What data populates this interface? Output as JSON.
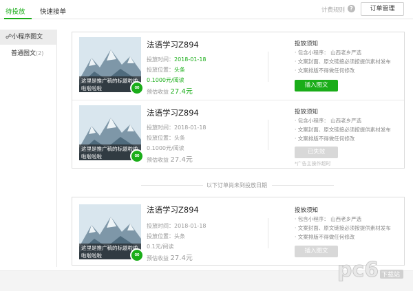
{
  "header": {
    "tabs": [
      {
        "label": "待投放"
      },
      {
        "label": "快速接单"
      }
    ],
    "billing_rules": "计费规则",
    "help_icon": "?",
    "order_manage": "订单管理"
  },
  "sidebar": {
    "items": [
      {
        "label": "小程序图文",
        "count": ""
      },
      {
        "label": "普通图文",
        "count": "(2)"
      }
    ]
  },
  "cards": [
    {
      "caption": "这里是推广稿的标题啦啦啦啦啦啦",
      "title": "法语学习Z894",
      "time_label": "投放时间：",
      "time": "2018-01-18",
      "position_label": "投放位置：",
      "position": "头条",
      "price": "0.1000元/阅读",
      "earn_label": "预估收益",
      "earn": "27.4元",
      "notice_title": "投放须知",
      "notices": [
        "· 包含小程序：  山西老乡严选",
        "· 文案封面、原文链接必须按提供素材发布",
        "· 文案排版不得做任何修改"
      ],
      "button": "插入图文",
      "button_state": "active",
      "note": ""
    },
    {
      "caption": "这里是推广稿的标题啦啦啦啦啦啦",
      "title": "法语学习Z894",
      "time_label": "投放时间：",
      "time": "2018-01-18",
      "position_label": "投放位置：",
      "position": "头条",
      "price": "0.1000元/阅读",
      "earn_label": "预估收益",
      "earn": "27.4元",
      "notice_title": "投放须知",
      "notices": [
        "· 包含小程序：  山西老乡严选",
        "· 文案封面、原文链接必须按提供素材发布",
        "· 文案排版不得做任何修改"
      ],
      "button": "已失效",
      "button_state": "disabled",
      "note": "*广告主操作超时"
    }
  ],
  "divider_text": "以下订单尚未到投放日期",
  "pending_card": {
    "caption": "这里是推广稿的标题啦啦啦啦啦啦",
    "title": "法语学习Z894",
    "time_label": "投放时间：",
    "time": "2018-01-18",
    "position_label": "投放位置：",
    "position": "头条",
    "price": "0.1元/阅读",
    "earn_label": "预估收益",
    "earn": "27.4元",
    "notice_title": "投放须知",
    "notices": [
      "· 包含小程序：  山西老乡严选",
      "· 文案封面、原文链接必须按提供素材发布",
      "· 文案排版不得做任何修改"
    ],
    "button": "插入图文",
    "button_state": "disabled"
  },
  "watermark": {
    "brand": "pc6",
    "sub": "下载站"
  },
  "colors": {
    "accent": "#1aad19",
    "border": "#dcdcdc",
    "muted": "#999999"
  }
}
